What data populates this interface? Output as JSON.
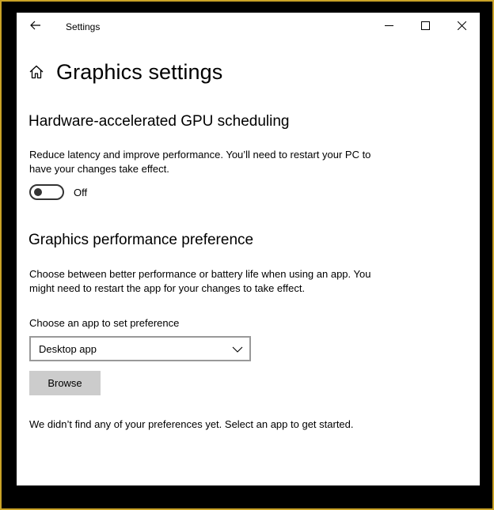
{
  "window": {
    "title": "Settings",
    "controls": {
      "back_icon": "arrow-left",
      "minimize_icon": "minimize",
      "maximize_icon": "maximize",
      "close_icon": "close"
    }
  },
  "page": {
    "title": "Graphics settings",
    "home_icon": "home"
  },
  "gpu_scheduling": {
    "heading": "Hardware-accelerated GPU scheduling",
    "description": "Reduce latency and improve performance. You’ll need to restart your PC to have your changes take effect.",
    "toggle_state": "Off"
  },
  "performance_preference": {
    "heading": "Graphics performance preference",
    "description": "Choose between better performance or battery life when using an app. You might need to restart the app for your changes to take effect.",
    "choose_label": "Choose an app to set preference",
    "dropdown_value": "Desktop app",
    "browse_label": "Browse",
    "empty_message": "We didn’t find any of your preferences yet. Select an app to get started."
  },
  "colors": {
    "frame_border": "#c9a227",
    "background": "#ffffff",
    "button_gray": "#cccccc"
  }
}
